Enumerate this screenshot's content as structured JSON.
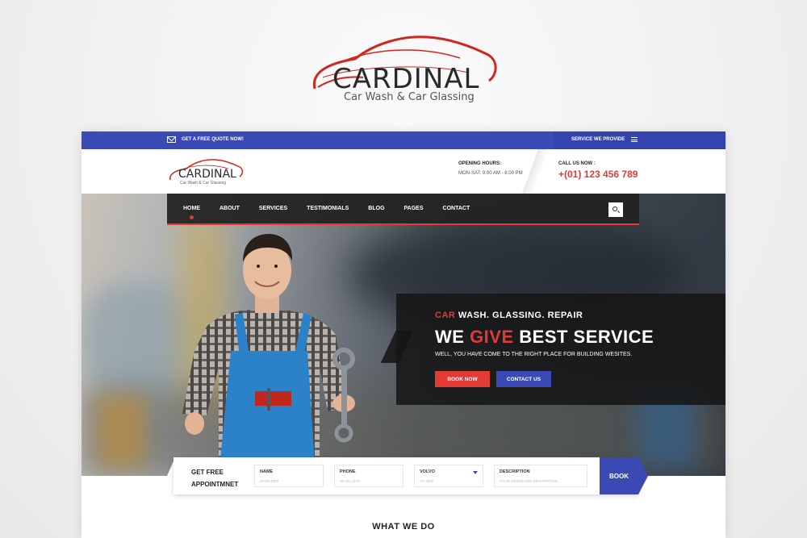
{
  "brand": {
    "name": "CARDINAL",
    "tagline": "Car Wash & Car Glassing",
    "colors": {
      "accent": "#e23b35",
      "primary": "#3b49b4",
      "dark": "#232323"
    }
  },
  "topbar": {
    "quote_label": "GET A FREE QUOTE NOW!",
    "services_label": "SERVICE WE PROVIDE"
  },
  "header": {
    "logo_name": "CARDINAL",
    "logo_tagline": "Car Wash & Car Glassing",
    "hours_label": "OPENING HOURS:",
    "hours_value": "MON-SAT:  9.00 AM - 8.00 PM",
    "call_label": "CALL US NOW :",
    "call_phone": "+(01) 123 456 789"
  },
  "nav": {
    "items": [
      {
        "label": "HOME",
        "active": true
      },
      {
        "label": "ABOUT"
      },
      {
        "label": "SERVICES"
      },
      {
        "label": "TESTIMONIALS"
      },
      {
        "label": "BLOG"
      },
      {
        "label": "PAGES"
      },
      {
        "label": "CONTACT"
      }
    ],
    "search_icon": "search-icon"
  },
  "hero": {
    "sub_red": "CAR",
    "sub_rest": " WASH.  GLASSING.  REPAIR",
    "headline_pre": "WE ",
    "headline_red": "GIVE",
    "headline_post": " BEST SERVICE",
    "description": "WELL, YOU HAVE COME TO THE RIGHT PLACE FOR BUILDING WESITES.",
    "book_label": "BOOK NOW",
    "contact_label": "CONTACT US"
  },
  "appointment": {
    "title_line1": "GET FREE",
    "title_line2": "APPOINTMNET",
    "fields": [
      {
        "label": "NAME",
        "placeholder": "JHON DEO"
      },
      {
        "label": "PHONE",
        "placeholder": "99 432 3210"
      },
      {
        "label": "VOLVO",
        "placeholder": "XX 3000"
      },
      {
        "label": "DESCRIPTION",
        "placeholder": "YOUR NEEDS AND DESCRIPTION"
      }
    ],
    "book_label": "BOOK"
  },
  "section": {
    "what_we_do": "WHAT WE DO"
  }
}
